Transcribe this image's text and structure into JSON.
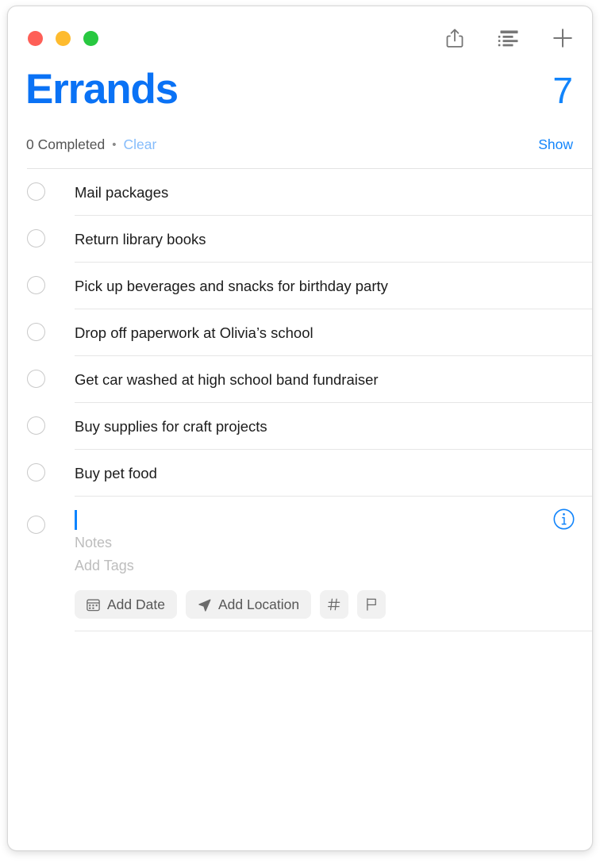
{
  "window": {
    "traffic_lights": [
      {
        "name": "close",
        "color": "#fe5f57"
      },
      {
        "name": "minimize",
        "color": "#febb2e"
      },
      {
        "name": "zoom",
        "color": "#28c840"
      }
    ]
  },
  "toolbar": {
    "share_label": "Share",
    "view_label": "View as List",
    "add_label": "New Reminder"
  },
  "list": {
    "title": "Errands",
    "count": "7",
    "completed_text": "0 Completed",
    "separator": "•",
    "clear_label": "Clear",
    "show_label": "Show"
  },
  "reminders": [
    {
      "title": "Mail packages"
    },
    {
      "title": "Return library books"
    },
    {
      "title": "Pick up beverages and snacks for birthday party"
    },
    {
      "title": "Drop off paperwork at Olivia’s school"
    },
    {
      "title": "Get car washed at high school band fundraiser"
    },
    {
      "title": "Buy supplies for craft projects"
    },
    {
      "title": "Buy pet food"
    }
  ],
  "editing": {
    "title_value": "",
    "notes_placeholder": "Notes",
    "tags_placeholder": "Add Tags",
    "info_label": "Info",
    "actions": [
      {
        "name": "add-date",
        "label": "Add Date",
        "icon": "calendar-icon"
      },
      {
        "name": "add-location",
        "label": "Add Location",
        "icon": "navigation-arrow-icon"
      },
      {
        "name": "add-tag",
        "label": "#",
        "icon": "hashtag-icon"
      },
      {
        "name": "add-flag",
        "label": "",
        "icon": "flag-icon"
      }
    ]
  },
  "colors": {
    "accent": "#0a72f5",
    "accent_light": "#85bcfb",
    "caret": "#0a84ff",
    "text": "#1c1c1c",
    "muted": "#bdbdbd"
  }
}
